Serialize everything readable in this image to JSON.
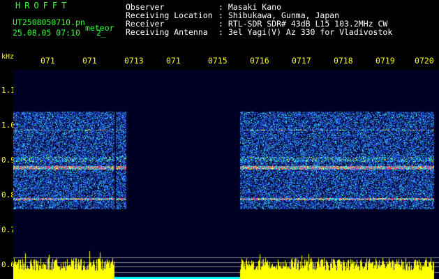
{
  "header": {
    "title": "HROFFT",
    "file_name": "UT2508050710.pn",
    "file_suffix": "meteor",
    "date_time": "25.08.05 07:10",
    "sub_value": "2_"
  },
  "station_info": [
    {
      "label": "Observer",
      "value": ": Masaki Kano"
    },
    {
      "label": "Receiving Location",
      "value": ": Shibukawa, Gunma, Japan"
    },
    {
      "label": "Receiver",
      "value": ": RTL-SDR SDR# 43dB L15 103.2MHz CW"
    },
    {
      "label": "Receiving Antenna",
      "value": ": 3el Yagi(V) Az 330 for Vladivostok"
    }
  ],
  "axis": {
    "unit": "kHz",
    "y_ticks": [
      "1.2",
      "1.1",
      "1.0",
      "0.9",
      "0.8",
      "0.7",
      "0.6"
    ],
    "x_ticks": [
      "071",
      "071",
      "0713",
      "071",
      "0715",
      "0716",
      "0717",
      "0718",
      "0719",
      "0720"
    ]
  },
  "colors": {
    "background": "#000000",
    "plot_background": "#000024",
    "header_text": "#33ff33",
    "info_text": "#ffffff",
    "axis_text": "#ffff00",
    "amplitude": "#ffff00",
    "baseline": "#00ffff"
  }
}
